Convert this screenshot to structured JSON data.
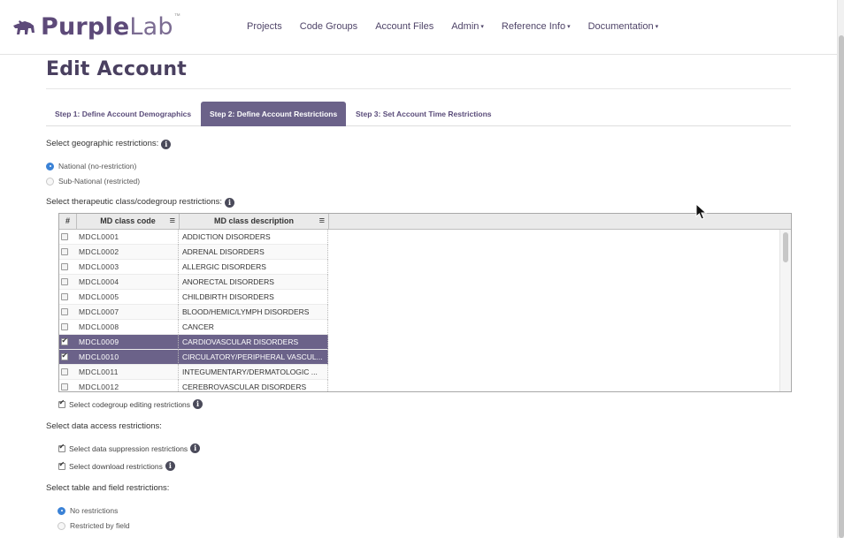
{
  "header": {
    "logo_text_a": "Purple",
    "logo_text_b": "Lab",
    "logo_tm": "™",
    "nav": [
      {
        "label": "Projects",
        "dropdown": false
      },
      {
        "label": "Code Groups",
        "dropdown": false
      },
      {
        "label": "Account Files",
        "dropdown": false
      },
      {
        "label": "Admin",
        "dropdown": true
      },
      {
        "label": "Reference Info",
        "dropdown": true
      },
      {
        "label": "Documentation",
        "dropdown": true
      }
    ]
  },
  "page": {
    "title": "Edit Account",
    "tabs": [
      {
        "label": "Step 1: Define Account Demographics",
        "active": false
      },
      {
        "label": "Step 2: Define Account Restrictions",
        "active": true
      },
      {
        "label": "Step 3: Set Account Time Restrictions",
        "active": false
      }
    ],
    "geo": {
      "label": "Select geographic restrictions:",
      "options": [
        {
          "label": "National (no-restriction)",
          "checked": true
        },
        {
          "label": "Sub-National (restricted)",
          "checked": false
        }
      ]
    },
    "therapeutic": {
      "label": "Select therapeutic class/codegroup restrictions:"
    },
    "grid": {
      "columns": [
        "#",
        "MD class code",
        "MD class description"
      ],
      "menu_glyph": "≡",
      "rows": [
        {
          "code": "MDCL0001",
          "desc": "ADDICTION DISORDERS",
          "checked": false
        },
        {
          "code": "MDCL0002",
          "desc": "ADRENAL DISORDERS",
          "checked": false
        },
        {
          "code": "MDCL0003",
          "desc": "ALLERGIC DISORDERS",
          "checked": false
        },
        {
          "code": "MDCL0004",
          "desc": "ANORECTAL DISORDERS",
          "checked": false
        },
        {
          "code": "MDCL0005",
          "desc": "CHILDBIRTH DISORDERS",
          "checked": false
        },
        {
          "code": "MDCL0007",
          "desc": "BLOOD/HEMIC/LYMPH DISORDERS",
          "checked": false
        },
        {
          "code": "MDCL0008",
          "desc": "CANCER",
          "checked": false
        },
        {
          "code": "MDCL0009",
          "desc": "CARDIOVASCULAR DISORDERS",
          "checked": true
        },
        {
          "code": "MDCL0010",
          "desc": "CIRCULATORY/PERIPHERAL VASCUL...",
          "checked": true
        },
        {
          "code": "MDCL0011",
          "desc": "INTEGUMENTARY/DERMATOLOGIC ...",
          "checked": false
        },
        {
          "code": "MDCL0012",
          "desc": "CEREBROVASCULAR DISORDERS",
          "checked": false
        }
      ]
    },
    "codegroup_editing": {
      "label": "Select codegroup editing restrictions",
      "checked": true
    },
    "data_access": {
      "label": "Select data access restrictions:",
      "options": [
        {
          "label": "Select data suppression restrictions",
          "checked": true
        },
        {
          "label": "Select download restrictions",
          "checked": true
        }
      ]
    },
    "table_field": {
      "label": "Select table and field restrictions:",
      "options": [
        {
          "label": "No restrictions",
          "checked": true
        },
        {
          "label": "Restricted by field",
          "checked": false
        }
      ]
    }
  },
  "colors": {
    "accent_purple": "#6b6289",
    "brand_purple": "#5d4a79",
    "radio_blue": "#3b82d6"
  },
  "icons": {
    "logo": "dog-logo-icon",
    "info": "info-icon",
    "column_menu": "hamburger-menu-icon",
    "cursor": "mouse-pointer-icon"
  }
}
